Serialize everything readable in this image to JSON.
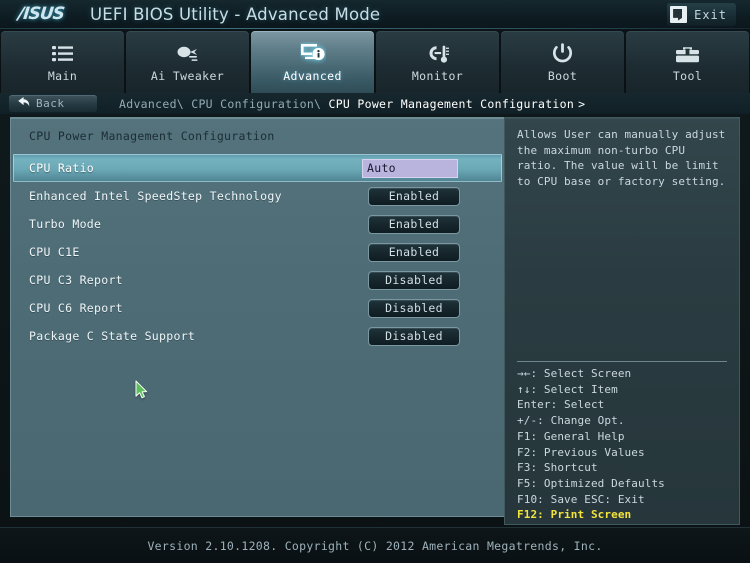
{
  "titlebar": {
    "logo": "/ISUS",
    "title": "UEFI BIOS Utility - Advanced Mode",
    "exit_label": "Exit",
    "exit_icon": "exit-door-icon"
  },
  "tabs": [
    {
      "label": "Main",
      "icon": "list-icon",
      "active": false
    },
    {
      "label": "Ai Tweaker",
      "icon": "comet-speed-icon",
      "active": false
    },
    {
      "label": "Advanced",
      "icon": "monitor-info-icon",
      "active": true
    },
    {
      "label": "Monitor",
      "icon": "gauge-temp-icon",
      "active": false
    },
    {
      "label": "Boot",
      "icon": "power-icon",
      "active": false
    },
    {
      "label": "Tool",
      "icon": "toolbox-icon",
      "active": false
    }
  ],
  "breadcrumb": {
    "back_label": "Back",
    "back_icon": "back-arrow-icon",
    "path_prefix": "Advanced\\ CPU Configuration\\ ",
    "path_current": "CPU Power Management Configuration",
    "caret": ">"
  },
  "main": {
    "section_title": "CPU Power Management Configuration",
    "rows": [
      {
        "label": "CPU Ratio",
        "value": "Auto",
        "selected": true
      },
      {
        "label": "Enhanced Intel SpeedStep Technology",
        "value": "Enabled",
        "selected": false
      },
      {
        "label": "Turbo Mode",
        "value": "Enabled",
        "selected": false
      },
      {
        "label": "CPU C1E",
        "value": "Enabled",
        "selected": false
      },
      {
        "label": "CPU C3 Report",
        "value": "Disabled",
        "selected": false
      },
      {
        "label": "CPU C6 Report",
        "value": "Disabled",
        "selected": false
      },
      {
        "label": "Package C State Support",
        "value": "Disabled",
        "selected": false
      }
    ]
  },
  "side": {
    "help_text": "Allows User can manually adjust the maximum non-turbo CPU ratio. The value will be limit to CPU base or factory setting.",
    "legend": [
      {
        "text": "→←: Select Screen",
        "highlight": false
      },
      {
        "text": "↑↓: Select Item",
        "highlight": false
      },
      {
        "text": "Enter: Select",
        "highlight": false
      },
      {
        "text": "+/-: Change Opt.",
        "highlight": false
      },
      {
        "text": "F1: General Help",
        "highlight": false
      },
      {
        "text": "F2: Previous Values",
        "highlight": false
      },
      {
        "text": "F3: Shortcut",
        "highlight": false
      },
      {
        "text": "F5: Optimized Defaults",
        "highlight": false
      },
      {
        "text": "F10: Save  ESC: Exit",
        "highlight": false
      },
      {
        "text": "F12: Print Screen",
        "highlight": true
      }
    ]
  },
  "footer": {
    "text": "Version 2.10.1208. Copyright (C) 2012 American Megatrends, Inc."
  },
  "colors": {
    "accent_cyan": "#74b2c0",
    "panel_slate": "#4e6c76",
    "side_panel": "#2a3c41",
    "value_lavender": "#b9b4dd",
    "legend_highlight": "#f3e43c"
  }
}
